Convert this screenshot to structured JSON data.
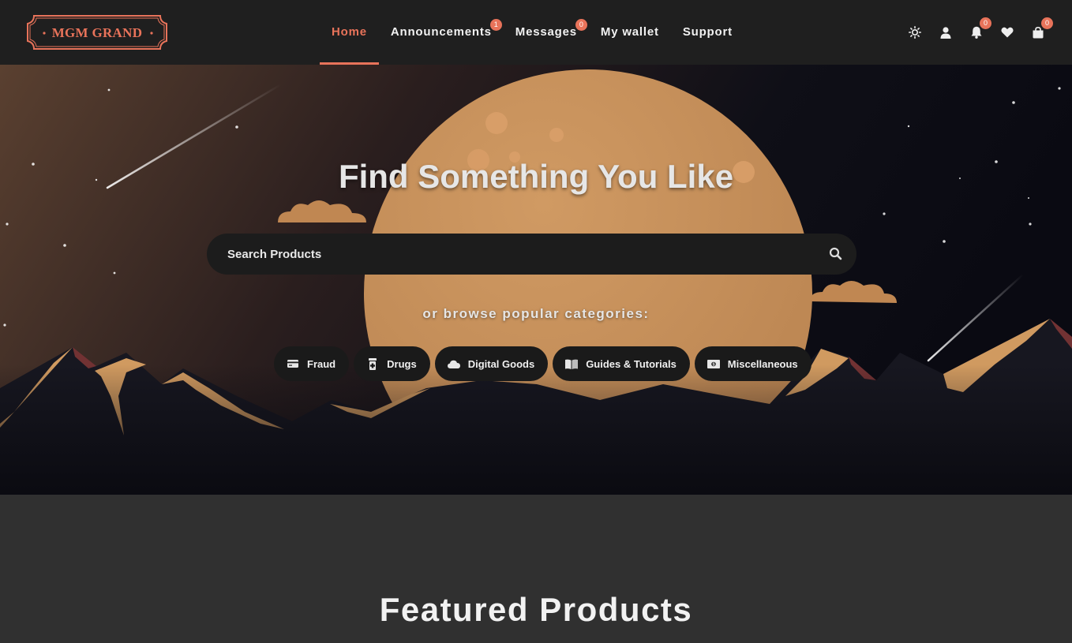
{
  "brand": {
    "logo_text": "MGM GRAND"
  },
  "nav": {
    "items": [
      {
        "label": "Home",
        "active": true
      },
      {
        "label": "Announcements",
        "badge": "1"
      },
      {
        "label": "Messages",
        "badge": "0"
      },
      {
        "label": "My wallet"
      },
      {
        "label": "Support"
      }
    ]
  },
  "header_icons": {
    "theme": "sun-icon",
    "account": "user-icon",
    "notifications": {
      "icon": "bell-icon",
      "badge": "0"
    },
    "wishlist": "heart-icon",
    "cart": {
      "icon": "shopping-bag-icon",
      "badge": "0"
    }
  },
  "hero": {
    "title": "Find Something You Like",
    "search_placeholder": "Search Products",
    "browse_text": "or browse popular categories:",
    "categories": [
      {
        "label": "Fraud",
        "icon": "credit-card-icon"
      },
      {
        "label": "Drugs",
        "icon": "pill-bottle-icon"
      },
      {
        "label": "Digital Goods",
        "icon": "cloud-icon"
      },
      {
        "label": "Guides & Tutorials",
        "icon": "book-icon"
      },
      {
        "label": "Miscellaneous",
        "icon": "money-bill-icon"
      }
    ]
  },
  "featured": {
    "title": "Featured Products"
  },
  "colors": {
    "accent": "#e8735a",
    "header_bg": "#1f1f1f",
    "section_bg": "#303030",
    "moon": "#c8915c"
  }
}
